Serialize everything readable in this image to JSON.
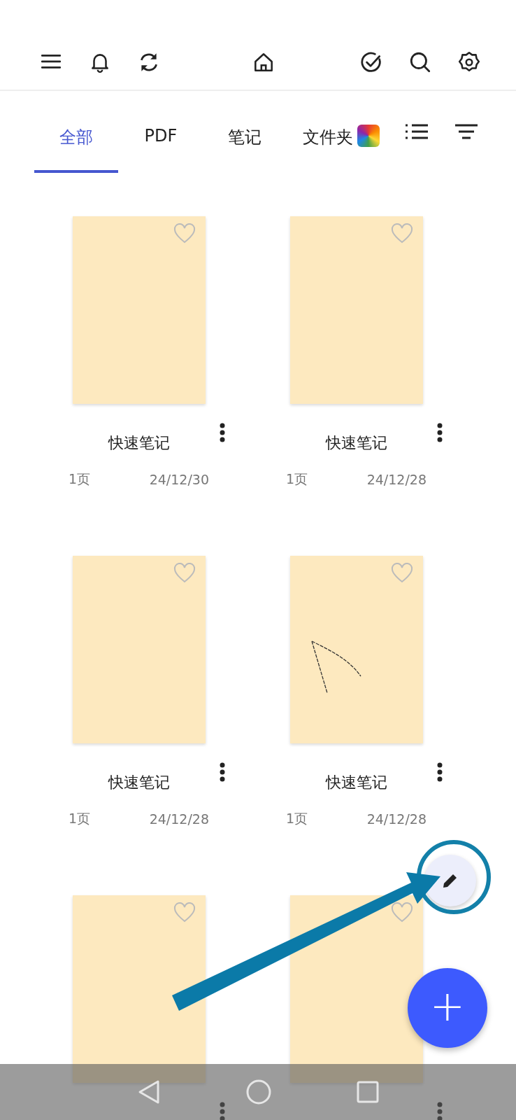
{
  "tabs": [
    {
      "label": "全部",
      "selected": true
    },
    {
      "label": "PDF",
      "selected": false
    },
    {
      "label": "笔记",
      "selected": false
    },
    {
      "label": "文件夹",
      "selected": false
    }
  ],
  "notes": [
    {
      "title": "快速笔记",
      "pages": "1页",
      "date": "24/12/30",
      "favorite": false,
      "kind": "blank"
    },
    {
      "title": "快速笔记",
      "pages": "1页",
      "date": "24/12/28",
      "favorite": false,
      "kind": "blank"
    },
    {
      "title": "快速笔记",
      "pages": "1页",
      "date": "24/12/28",
      "favorite": false,
      "kind": "blank"
    },
    {
      "title": "快速笔记",
      "pages": "1页",
      "date": "24/12/28",
      "favorite": false,
      "kind": "sketch"
    },
    {
      "favorite": false,
      "kind": "blank"
    },
    {
      "favorite": false,
      "kind": "blank"
    }
  ],
  "fab": {
    "label": "+"
  }
}
